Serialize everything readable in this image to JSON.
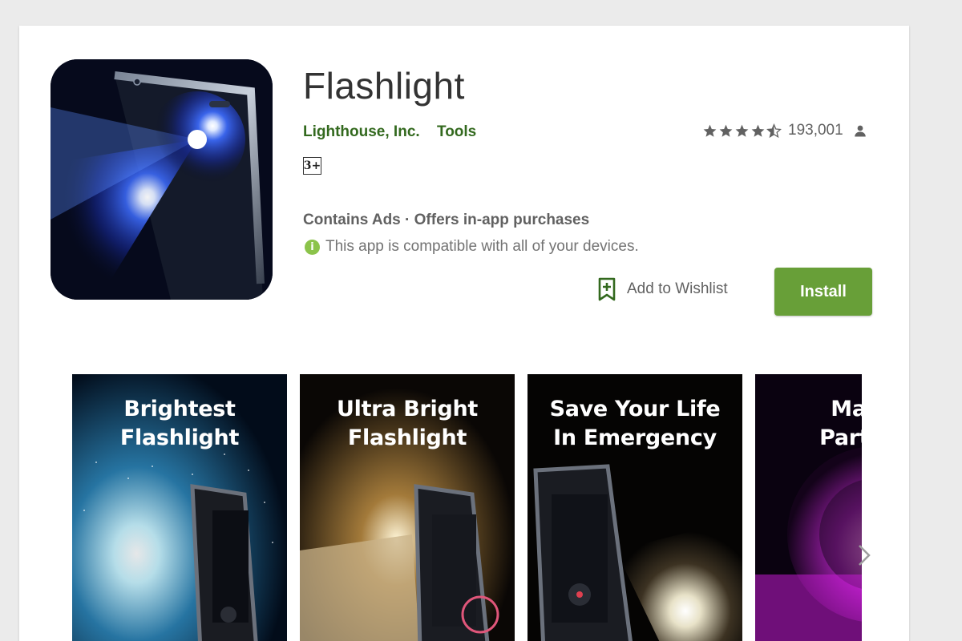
{
  "app": {
    "title": "Flashlight",
    "developer": "Lighthouse, Inc.",
    "category": "Tools",
    "rating_value": 4.5,
    "rating_count": "193,001",
    "content_rating": "3+",
    "ads_line": "Contains Ads · Offers in-app purchases",
    "compat_text": "This app is compatible with all of your devices.",
    "wishlist_label": "Add to Wishlist",
    "install_label": "Install"
  },
  "screenshots": [
    {
      "caption": "Brightest\nFlashlight"
    },
    {
      "caption": "Ultra Bright\nFlashlight"
    },
    {
      "caption": "Save Your Life\nIn Emergency"
    },
    {
      "caption": "Make\nParty S"
    }
  ],
  "colors": {
    "accent_green": "#33691e",
    "install_green": "#689f38",
    "info_green": "#8bc34a"
  },
  "icons": [
    "star-icon",
    "person-icon",
    "info-icon",
    "bookmark-add-icon",
    "chevron-right-icon"
  ]
}
